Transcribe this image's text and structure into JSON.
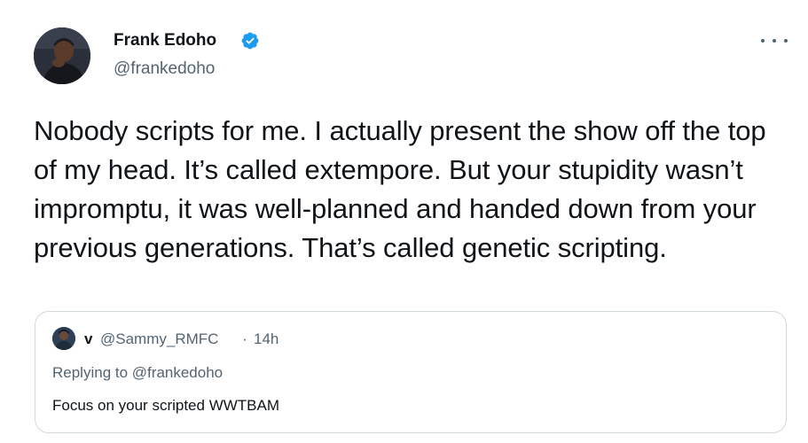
{
  "author": {
    "display_name": "Frank Edoho",
    "handle": "@frankedoho",
    "verified": true
  },
  "tweet_text": "Nobody scripts for me. I actually present the show off the top of my head. It’s called extempore. But your stupidity wasn’t impromptu, it was well-planned and handed down from your previous generations. That’s called genetic scripting.",
  "quoted_tweet": {
    "display_name": "v",
    "handle": "@Sammy_RMFC",
    "separator": "·",
    "time": "14h",
    "replying_prefix": "Replying to",
    "replying_to": "@frankedoho",
    "text": "Focus on your scripted WWTBAM"
  },
  "colors": {
    "text_primary": "#0f1419",
    "text_secondary": "#536471",
    "verified_blue": "#1d9bf0",
    "border": "#cfd9de"
  },
  "icons": {
    "verified": "verified-badge-icon",
    "more": "more-horizontal-icon"
  }
}
